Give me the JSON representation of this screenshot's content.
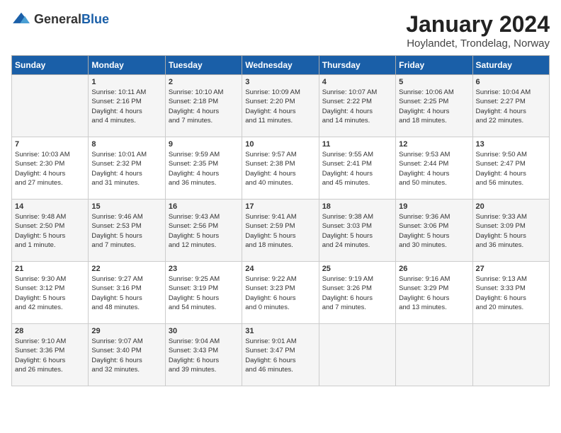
{
  "header": {
    "logo": {
      "general": "General",
      "blue": "Blue"
    },
    "title": "January 2024",
    "subtitle": "Hoylandet, Trondelag, Norway"
  },
  "columns": [
    "Sunday",
    "Monday",
    "Tuesday",
    "Wednesday",
    "Thursday",
    "Friday",
    "Saturday"
  ],
  "weeks": [
    [
      {
        "day": "",
        "content": ""
      },
      {
        "day": "1",
        "content": "Sunrise: 10:11 AM\nSunset: 2:16 PM\nDaylight: 4 hours\nand 4 minutes."
      },
      {
        "day": "2",
        "content": "Sunrise: 10:10 AM\nSunset: 2:18 PM\nDaylight: 4 hours\nand 7 minutes."
      },
      {
        "day": "3",
        "content": "Sunrise: 10:09 AM\nSunset: 2:20 PM\nDaylight: 4 hours\nand 11 minutes."
      },
      {
        "day": "4",
        "content": "Sunrise: 10:07 AM\nSunset: 2:22 PM\nDaylight: 4 hours\nand 14 minutes."
      },
      {
        "day": "5",
        "content": "Sunrise: 10:06 AM\nSunset: 2:25 PM\nDaylight: 4 hours\nand 18 minutes."
      },
      {
        "day": "6",
        "content": "Sunrise: 10:04 AM\nSunset: 2:27 PM\nDaylight: 4 hours\nand 22 minutes."
      }
    ],
    [
      {
        "day": "7",
        "content": "Sunrise: 10:03 AM\nSunset: 2:30 PM\nDaylight: 4 hours\nand 27 minutes."
      },
      {
        "day": "8",
        "content": "Sunrise: 10:01 AM\nSunset: 2:32 PM\nDaylight: 4 hours\nand 31 minutes."
      },
      {
        "day": "9",
        "content": "Sunrise: 9:59 AM\nSunset: 2:35 PM\nDaylight: 4 hours\nand 36 minutes."
      },
      {
        "day": "10",
        "content": "Sunrise: 9:57 AM\nSunset: 2:38 PM\nDaylight: 4 hours\nand 40 minutes."
      },
      {
        "day": "11",
        "content": "Sunrise: 9:55 AM\nSunset: 2:41 PM\nDaylight: 4 hours\nand 45 minutes."
      },
      {
        "day": "12",
        "content": "Sunrise: 9:53 AM\nSunset: 2:44 PM\nDaylight: 4 hours\nand 50 minutes."
      },
      {
        "day": "13",
        "content": "Sunrise: 9:50 AM\nSunset: 2:47 PM\nDaylight: 4 hours\nand 56 minutes."
      }
    ],
    [
      {
        "day": "14",
        "content": "Sunrise: 9:48 AM\nSunset: 2:50 PM\nDaylight: 5 hours\nand 1 minute."
      },
      {
        "day": "15",
        "content": "Sunrise: 9:46 AM\nSunset: 2:53 PM\nDaylight: 5 hours\nand 7 minutes."
      },
      {
        "day": "16",
        "content": "Sunrise: 9:43 AM\nSunset: 2:56 PM\nDaylight: 5 hours\nand 12 minutes."
      },
      {
        "day": "17",
        "content": "Sunrise: 9:41 AM\nSunset: 2:59 PM\nDaylight: 5 hours\nand 18 minutes."
      },
      {
        "day": "18",
        "content": "Sunrise: 9:38 AM\nSunset: 3:03 PM\nDaylight: 5 hours\nand 24 minutes."
      },
      {
        "day": "19",
        "content": "Sunrise: 9:36 AM\nSunset: 3:06 PM\nDaylight: 5 hours\nand 30 minutes."
      },
      {
        "day": "20",
        "content": "Sunrise: 9:33 AM\nSunset: 3:09 PM\nDaylight: 5 hours\nand 36 minutes."
      }
    ],
    [
      {
        "day": "21",
        "content": "Sunrise: 9:30 AM\nSunset: 3:12 PM\nDaylight: 5 hours\nand 42 minutes."
      },
      {
        "day": "22",
        "content": "Sunrise: 9:27 AM\nSunset: 3:16 PM\nDaylight: 5 hours\nand 48 minutes."
      },
      {
        "day": "23",
        "content": "Sunrise: 9:25 AM\nSunset: 3:19 PM\nDaylight: 5 hours\nand 54 minutes."
      },
      {
        "day": "24",
        "content": "Sunrise: 9:22 AM\nSunset: 3:23 PM\nDaylight: 6 hours\nand 0 minutes."
      },
      {
        "day": "25",
        "content": "Sunrise: 9:19 AM\nSunset: 3:26 PM\nDaylight: 6 hours\nand 7 minutes."
      },
      {
        "day": "26",
        "content": "Sunrise: 9:16 AM\nSunset: 3:29 PM\nDaylight: 6 hours\nand 13 minutes."
      },
      {
        "day": "27",
        "content": "Sunrise: 9:13 AM\nSunset: 3:33 PM\nDaylight: 6 hours\nand 20 minutes."
      }
    ],
    [
      {
        "day": "28",
        "content": "Sunrise: 9:10 AM\nSunset: 3:36 PM\nDaylight: 6 hours\nand 26 minutes."
      },
      {
        "day": "29",
        "content": "Sunrise: 9:07 AM\nSunset: 3:40 PM\nDaylight: 6 hours\nand 32 minutes."
      },
      {
        "day": "30",
        "content": "Sunrise: 9:04 AM\nSunset: 3:43 PM\nDaylight: 6 hours\nand 39 minutes."
      },
      {
        "day": "31",
        "content": "Sunrise: 9:01 AM\nSunset: 3:47 PM\nDaylight: 6 hours\nand 46 minutes."
      },
      {
        "day": "",
        "content": ""
      },
      {
        "day": "",
        "content": ""
      },
      {
        "day": "",
        "content": ""
      }
    ]
  ]
}
